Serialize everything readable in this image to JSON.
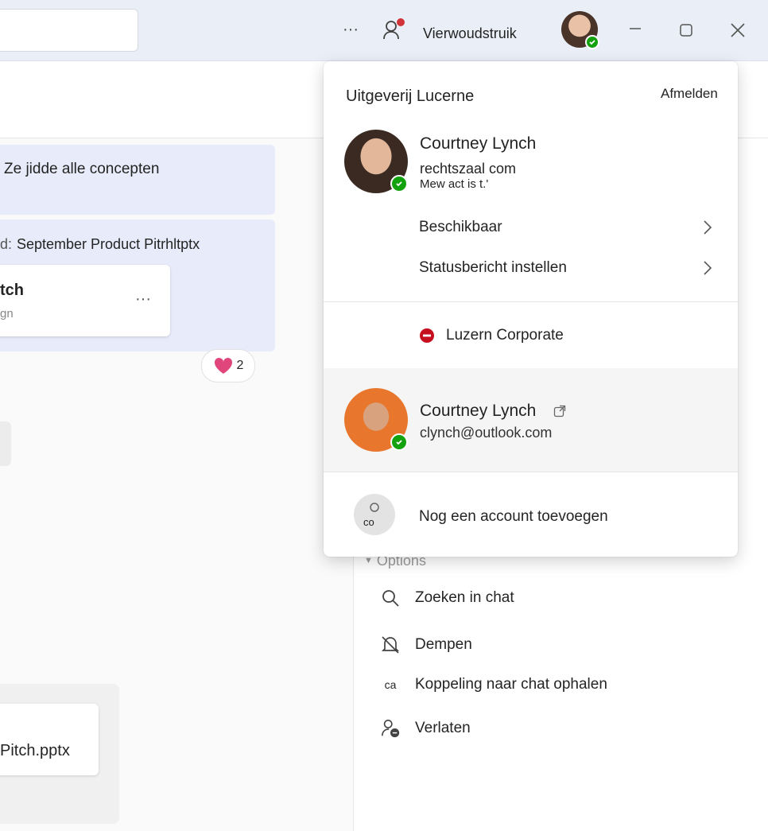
{
  "titlebar": {
    "more_label": "···",
    "org_name": "Vierwoudstruik"
  },
  "chat": {
    "msg1": "Ze jidde alle concepten",
    "msg2_prefix": "d:",
    "msg2_text": "September Product Pitrhltptx",
    "card_title": "tch",
    "card_subtitle": "gn",
    "card_more": "···",
    "reaction_count": "2",
    "file_name": "Pitch.pptx"
  },
  "options": {
    "header": "Options",
    "items": [
      {
        "label": "Zoeken in chat",
        "icon": "search-icon"
      },
      {
        "label": "Dempen",
        "icon": "mute-bell-icon"
      },
      {
        "label": "Koppeling naar chat ophalen",
        "icon": "link-icon",
        "icon_text": "ca"
      },
      {
        "label": "Verlaten",
        "icon": "leave-icon"
      }
    ]
  },
  "account_menu": {
    "org": "Uitgeverij Lucerne",
    "signout": "Afmelden",
    "primary": {
      "name": "Courtney Lynch",
      "email": "rechtszaal com",
      "note": "Mew act is t.'"
    },
    "status_available": "Beschikbaar",
    "status_message": "Statusbericht instellen",
    "corporate": "Luzern Corporate",
    "secondary": {
      "name": "Courtney Lynch",
      "email": "clynch@outlook.com"
    },
    "add_account": "Nog een account toevoegen",
    "add_account_initials": "co"
  },
  "colors": {
    "presence": "#13a10e",
    "dnd": "#c50f1f",
    "bubble": "#e8ebfa",
    "titlebar": "#eaeff7"
  }
}
